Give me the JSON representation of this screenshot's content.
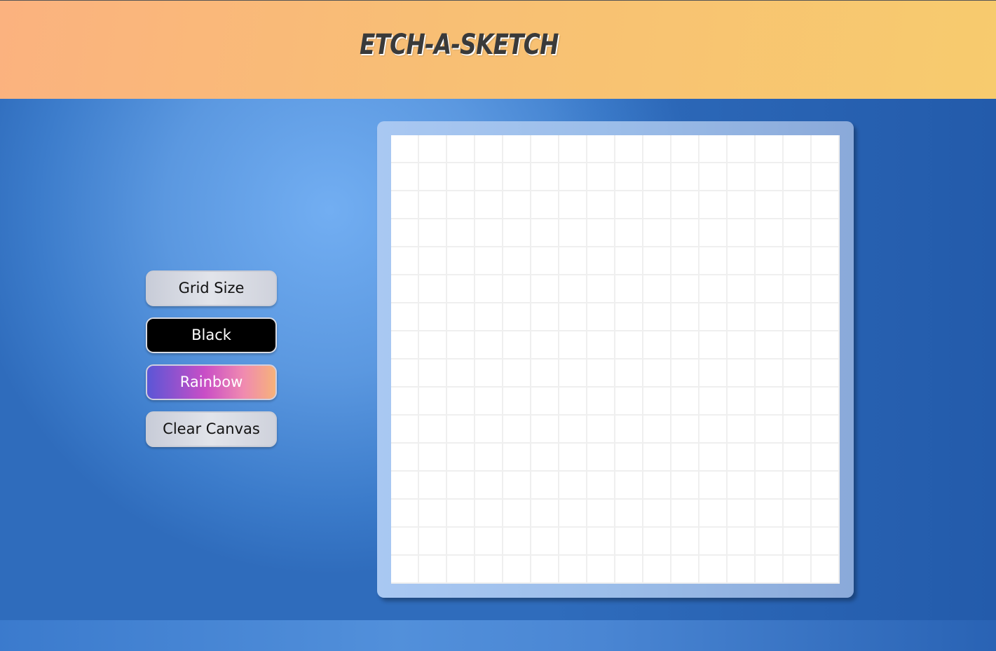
{
  "header": {
    "title": "ETCH-A-SKETCH"
  },
  "controls": {
    "grid_size_label": "Grid Size",
    "black_label": "Black",
    "rainbow_label": "Rainbow",
    "clear_label": "Clear Canvas"
  },
  "canvas": {
    "grid_size": 16
  },
  "colors": {
    "header_start": "#fbb27f",
    "header_end": "#f7cb6e",
    "background": "#5b98e0",
    "frame": "#9bbde9",
    "canvas": "#ffffff",
    "grid_line": "#efefef"
  }
}
